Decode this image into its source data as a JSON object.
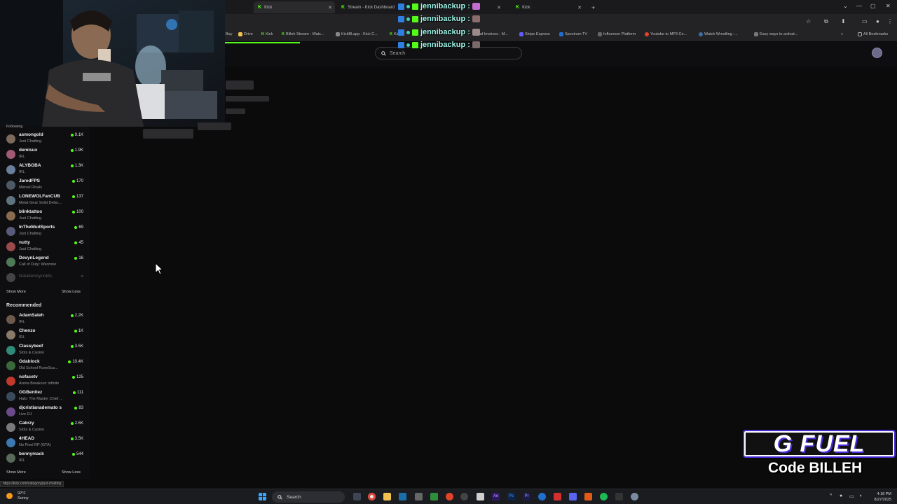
{
  "browser": {
    "tabs": [
      {
        "label": "Kick",
        "active": true
      },
      {
        "label": "Stream - Kick Dashboard",
        "active": false
      },
      {
        "label": "Kick",
        "active": false
      }
    ],
    "new_tab": "+",
    "window_controls": [
      "—",
      "▢",
      "✕"
    ],
    "bookmarks": [
      {
        "label": "Bay"
      },
      {
        "label": "Drive"
      },
      {
        "label": "Kick"
      },
      {
        "label": "Billeh Stream - Watc..."
      },
      {
        "label": "KickBLapp - Kick C..."
      },
      {
        "label": "Kick"
      },
      {
        "label": "and Invoices - M..."
      },
      {
        "label": "Stripe Express"
      },
      {
        "label": "Spectrum TV"
      },
      {
        "label": "Influencer Platform"
      },
      {
        "label": "Youtube to MP3 Co..."
      },
      {
        "label": "Watch Wrestling -..."
      },
      {
        "label": "Easy ways to activat..."
      }
    ],
    "all_bookmarks": "All Bookmarks",
    "status_url": "https://kick.com/category/just-chatting"
  },
  "header": {
    "search_placeholder": "Search"
  },
  "chat_overlay": [
    {
      "user": "jennibackup :"
    },
    {
      "user": "jennibackup :"
    },
    {
      "user": "jennibackup :"
    },
    {
      "user": "jennibackup :"
    }
  ],
  "sidebar": {
    "following_title": "Following",
    "following": [
      {
        "name": "asmongold",
        "category": "Just Chatting",
        "viewers": "9.1K",
        "color": "#7c6a5c"
      },
      {
        "name": "demisux",
        "category": "IRL",
        "viewers": "1.9K",
        "color": "#a25a74"
      },
      {
        "name": "ALYBOBA",
        "category": "IRL",
        "viewers": "1.3K",
        "color": "#6a7f9c"
      },
      {
        "name": "JaredFPS",
        "category": "Marvel Rivals",
        "viewers": "170",
        "color": "#4d5a66"
      },
      {
        "name": "LONEWOLFanCUB",
        "category": "Metal Gear Solid Delta:...",
        "viewers": "137",
        "color": "#5e7480"
      },
      {
        "name": "blinktattoo",
        "category": "Just Chatting",
        "viewers": "100",
        "color": "#8a6b4f"
      },
      {
        "name": "InTheMudSports",
        "category": "Just Chatting",
        "viewers": "69",
        "color": "#5a5a7a"
      },
      {
        "name": "nutty",
        "category": "Just Chatting",
        "viewers": "45",
        "color": "#9a4a4a"
      },
      {
        "name": "DevynLegend",
        "category": "Call of Duty: Warzone",
        "viewers": "16",
        "color": "#4f7a57"
      }
    ],
    "offline": {
      "name": "Natalierreynolds",
      "color": "#555"
    },
    "show_more": "Show More",
    "show_less": "Show Less",
    "recommended_title": "Recommended",
    "recommended": [
      {
        "name": "AdamSaleh",
        "category": "IRL",
        "viewers": "2.2K",
        "color": "#6c5a4a"
      },
      {
        "name": "Chenzo",
        "category": "IRL",
        "viewers": "1K",
        "color": "#8a7a6a"
      },
      {
        "name": "Classybeef",
        "category": "Slots & Casino",
        "viewers": "3.5K",
        "color": "#2f8a7a"
      },
      {
        "name": "Odablock",
        "category": "Old School RuneSca...",
        "viewers": "10.4K",
        "color": "#3a6a3a"
      },
      {
        "name": "nofacetv",
        "category": "Arena Breakout: Infinite",
        "viewers": "125",
        "color": "#c0392b"
      },
      {
        "name": "OGBenitez",
        "category": "Halo: The Master Chief ...",
        "viewers": "111",
        "color": "#3a4a5a"
      },
      {
        "name": "djcristianademato s",
        "category": "Live DJ",
        "viewers": "83",
        "color": "#6a4a8a"
      },
      {
        "name": "Cabrzy",
        "category": "Slots & Casino",
        "viewers": "2.6K",
        "color": "#7a7a7a"
      },
      {
        "name": "4HEAD",
        "category": "No Pixel RP (GTA)",
        "viewers": "3.5K",
        "color": "#3a7ab0"
      },
      {
        "name": "bennymack",
        "category": "IRL",
        "viewers": "544",
        "color": "#5a6a5a"
      }
    ]
  },
  "sponsor": {
    "logo": "G FUEL",
    "code": "Code BILLEH"
  },
  "taskbar": {
    "weather_temp": "92°F",
    "weather_desc": "Sunny",
    "search": "Search",
    "time": "4:18 PM",
    "date": "8/27/2025"
  },
  "colors": {
    "kick_green": "#53fc18",
    "chat_name": "#9ff6ea",
    "gfuel_purple": "#4a2bd6"
  }
}
